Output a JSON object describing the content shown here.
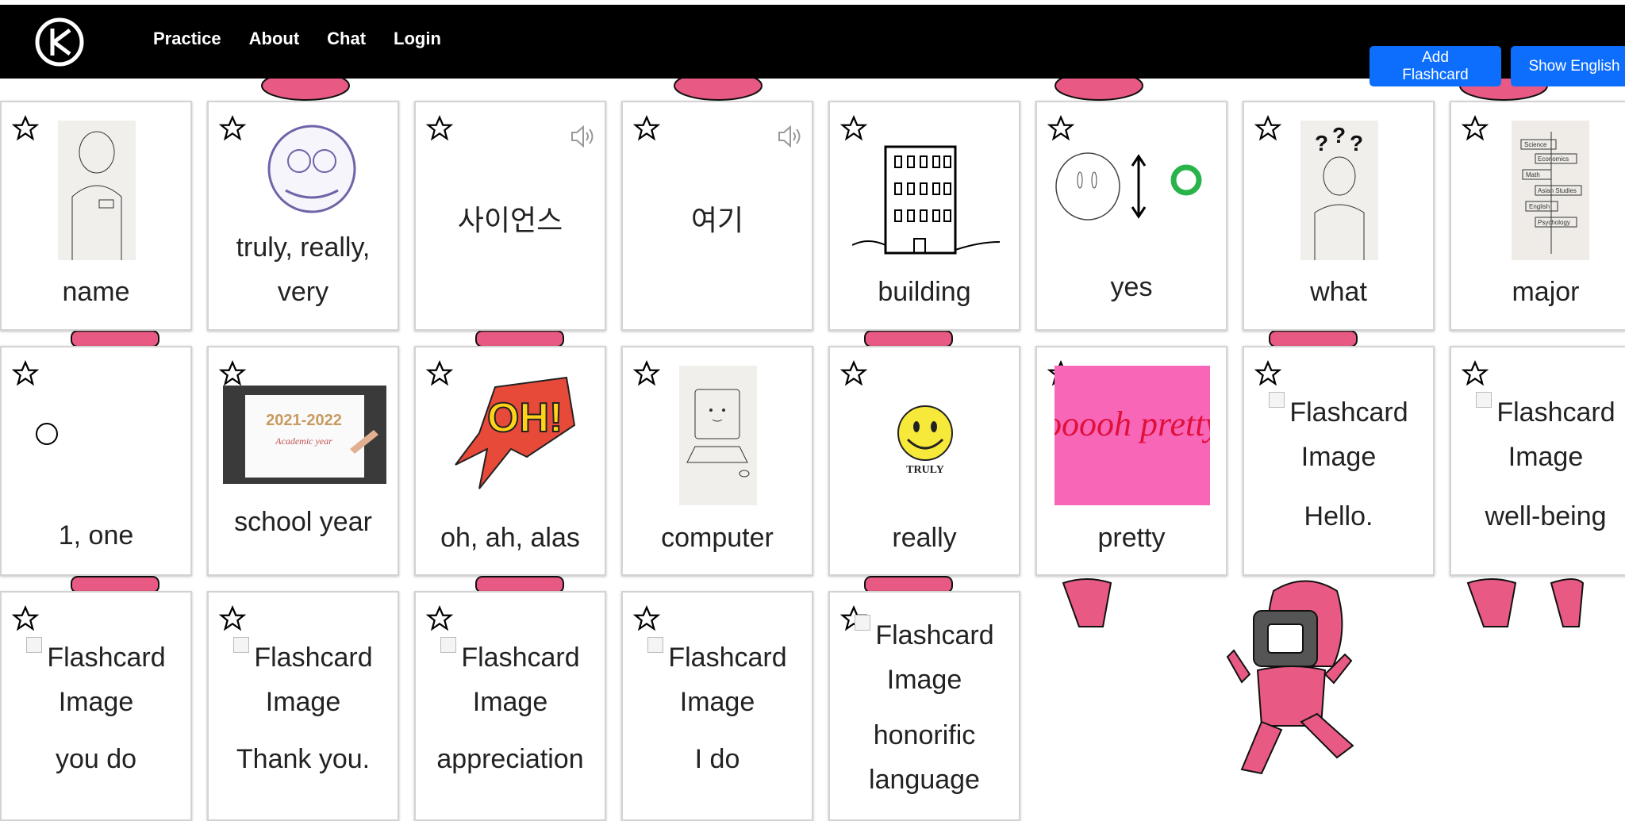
{
  "nav": {
    "links": [
      "Practice",
      "About",
      "Chat",
      "Login"
    ]
  },
  "buttons": {
    "add": "Add Flashcard",
    "show": "Show English"
  },
  "broken_image_alt": "Flashcard Image",
  "cards": {
    "name": "name",
    "truly": "truly, really, very",
    "science": "사이언스",
    "here": "여기",
    "building": "building",
    "yes": "yes",
    "what": "what",
    "major": "major",
    "one": "1, one",
    "school_year": "school year",
    "oh": "oh, ah, alas",
    "computer": "computer",
    "really": "really",
    "pretty": "pretty",
    "hello": "Hello.",
    "wellbeing": "well-being",
    "you_do": "you do",
    "thank_you": "Thank you.",
    "appreciation": "appreciation",
    "i_do": "I do",
    "honorific": "honorific language"
  },
  "image_text": {
    "school_year_title": "2021-2022",
    "school_year_sub": "Academic year",
    "oh_title": "OH!",
    "pretty_title": "ooooh pretty",
    "really_caption": "TRULY",
    "major_signs": [
      "Science",
      "Economics",
      "Math",
      "Asian Studies",
      "English",
      "Psychology"
    ]
  },
  "colors": {
    "navbar": "#000000",
    "button": "#0d6efd",
    "character_pink": "#e85a83",
    "pretty_bg": "#f866b8",
    "yes_circle": "#28b44a"
  }
}
